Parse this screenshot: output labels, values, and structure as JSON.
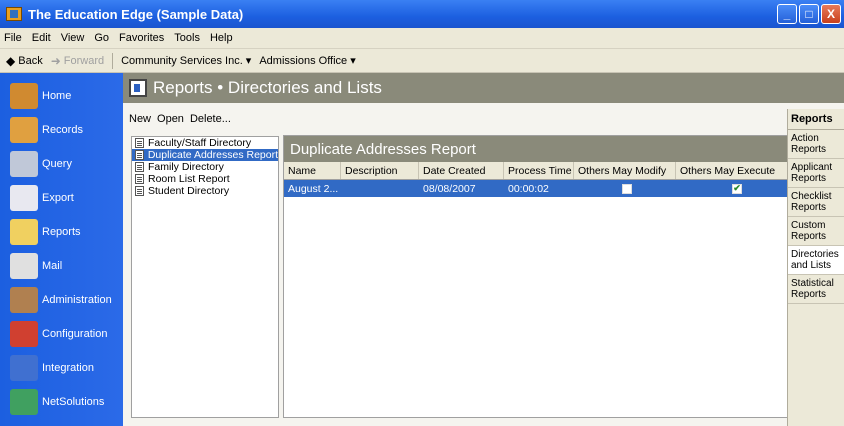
{
  "window": {
    "title": "The Education Edge (Sample Data)",
    "buttons": [
      "_",
      "□",
      "X"
    ]
  },
  "menu": [
    "File",
    "Edit",
    "View",
    "Go",
    "Favorites",
    "Tools",
    "Help"
  ],
  "nav": {
    "back": "Back",
    "forward": "Forward",
    "org": "Community Services Inc. ▾",
    "office": "Admissions Office ▾"
  },
  "sidebar": [
    {
      "label": "Home",
      "color": "#d08a30"
    },
    {
      "label": "Records",
      "color": "#e0a040"
    },
    {
      "label": "Query",
      "color": "#c0c8d8"
    },
    {
      "label": "Export",
      "color": "#e8e8f0"
    },
    {
      "label": "Reports",
      "color": "#f0d060"
    },
    {
      "label": "Mail",
      "color": "#e0e0e0"
    },
    {
      "label": "Administration",
      "color": "#b08050"
    },
    {
      "label": "Configuration",
      "color": "#d04030"
    },
    {
      "label": "Integration",
      "color": "#4070d0"
    },
    {
      "label": "NetSolutions",
      "color": "#40a060"
    }
  ],
  "page": {
    "title": "Reports • Directories and Lists"
  },
  "toolbar": {
    "new": "New",
    "open": "Open",
    "delete": "Delete..."
  },
  "tree": [
    "Faculty/Staff Directory",
    "Duplicate Addresses Report",
    "Family Directory",
    "Room List Report",
    "Student Directory"
  ],
  "grid": {
    "title": "Duplicate Addresses Report",
    "columns": [
      "Name",
      "Description",
      "Date Created",
      "Process Time",
      "Others May Modify",
      "Others May Execute"
    ],
    "row": {
      "name": "August 2...",
      "description": "",
      "date": "08/08/2007",
      "time": "00:00:02",
      "modify": "",
      "execute": "✔"
    }
  },
  "right_panel": {
    "title": "Reports",
    "items": [
      "Action Reports",
      "Applicant Reports",
      "Checklist Reports",
      "Custom Reports",
      "Directories and Lists",
      "Statistical Reports"
    ]
  }
}
